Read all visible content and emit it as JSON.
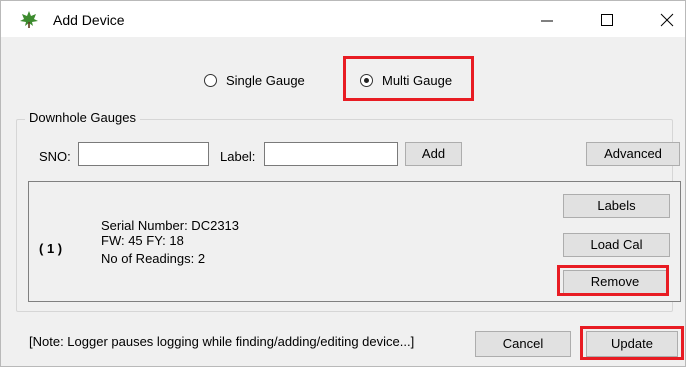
{
  "window": {
    "title": "Add Device",
    "minimize_icon": "minimize-icon",
    "maximize_icon": "maximize-icon",
    "close_icon": "close-icon",
    "app_icon": "leaf-icon",
    "app_icon_color": "#3d8b2f"
  },
  "mode": {
    "options": [
      {
        "label": "Single Gauge",
        "checked": false
      },
      {
        "label": "Multi Gauge",
        "checked": true
      }
    ]
  },
  "downhole": {
    "group_title": "Downhole Gauges",
    "sno_label": "SNO:",
    "sno_value": "",
    "label_label": "Label:",
    "label_value": "",
    "add_button": "Add",
    "advanced_button": "Advanced"
  },
  "gauge": {
    "index": "( 1 )",
    "serial": "Serial Number: DC2313",
    "fw": "FW: 45 FY: 18",
    "readings": "No of Readings: 2",
    "labels_button": "Labels",
    "load_cal_button": "Load Cal",
    "remove_button": "Remove"
  },
  "footer": {
    "note": "[Note: Logger pauses logging while finding/adding/editing device...]",
    "cancel_button": "Cancel",
    "update_button": "Update"
  },
  "colors": {
    "highlight": "#e81c23",
    "window_bg": "#f0f0f0",
    "button_bg": "#e1e1e1"
  }
}
